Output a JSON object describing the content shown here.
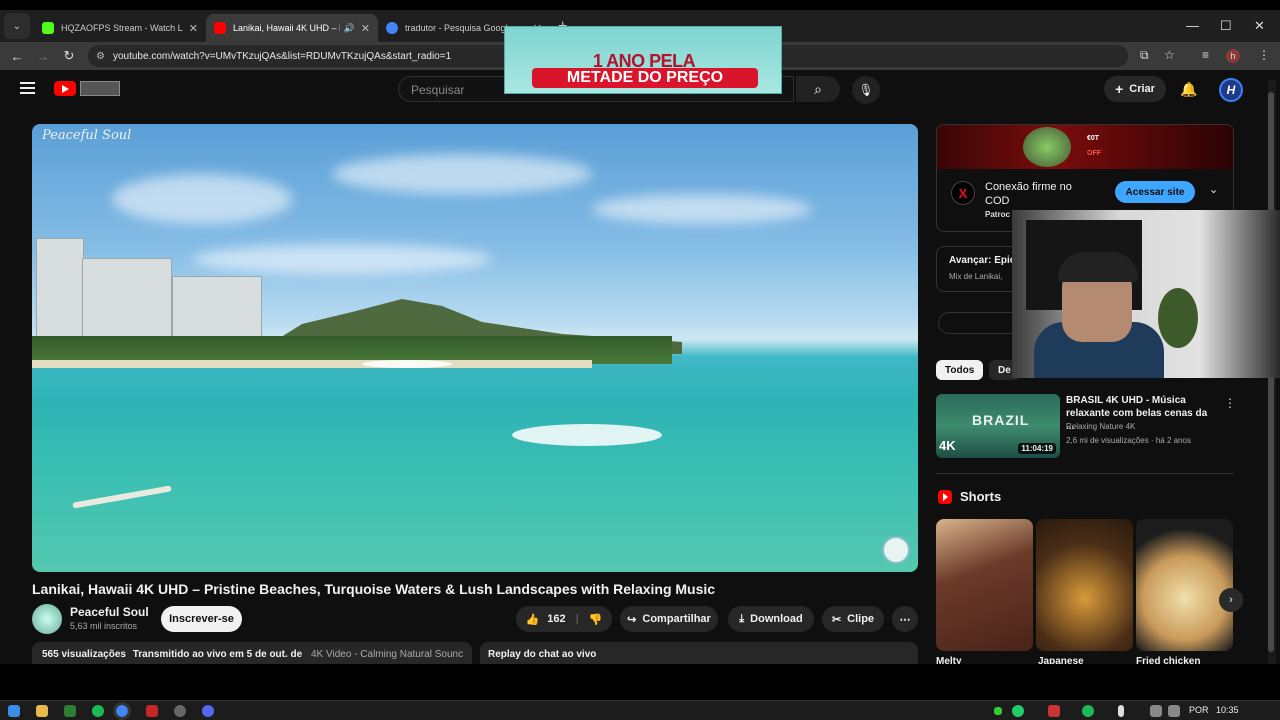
{
  "browser": {
    "tabs": [
      {
        "title": "HQZAOFPS Stream - Watch Live",
        "favicon_color": "#53fc18"
      },
      {
        "title": "Lanikai, Hawaii 4K UHD – P",
        "favicon_color": "#ff0000",
        "active": true
      },
      {
        "title": "tradutor - Pesquisa Google",
        "favicon_color": "#4285f4"
      }
    ],
    "url": "youtube.com/watch?v=UMvTKzujQAs&list=RDUMvTKzujQAs&start_radio=1",
    "profile_initial": "h"
  },
  "banner_ad": {
    "line1": "1 ANO PELA",
    "line2": "METADE DO PREÇO"
  },
  "header": {
    "search_placeholder": "Pesquisar",
    "create_label": "Criar",
    "avatar_letter": "H"
  },
  "player": {
    "watermark": "Peaceful Soul"
  },
  "video": {
    "title": "Lanikai, Hawaii 4K UHD – Pristine Beaches, Turquoise Waters & Lush Landscapes with Relaxing Music",
    "channel": "Peaceful Soul",
    "subscribers": "5,63 mil inscritos",
    "subscribe_label": "Inscrever-se",
    "likes": "162",
    "share_label": "Compartilhar",
    "download_label": "Download",
    "clip_label": "Clipe",
    "views": "565 visualizações",
    "streamed": "Transmitido ao vivo em 5 de out. de",
    "tags": "4K Video - Calming Natural Sounc",
    "chat_replay": "Replay do chat ao vivo"
  },
  "side_ad": {
    "tag_line1": "€0T",
    "tag_line2": "OFF",
    "logo": "X",
    "text": "Conexão firme no COD",
    "sponsored": "Patroc",
    "cta": "Acessar site"
  },
  "up_next": {
    "label": "Avançar: Epic",
    "sub": "Mix de Lanikai,"
  },
  "chips": [
    "Todos",
    "De"
  ],
  "related": {
    "thumb_title": "BRAZIL",
    "thumb_badge": "4K",
    "duration": "11:04:19",
    "title": "BRASIL 4K UHD - Música relaxante com belas cenas da ...",
    "channel": "Relaxing Nature 4K",
    "meta": "2,6 mi de visualizações · há 2 anos"
  },
  "shorts": {
    "title": "Shorts",
    "items": [
      {
        "label": "Melty",
        "colors": [
          "#6b3a2a",
          "#4a2418"
        ]
      },
      {
        "label": "Japanese",
        "colors": [
          "#4a2d16",
          "#b07a3a"
        ]
      },
      {
        "label": "Fried chicken",
        "colors": [
          "#1c1c1c",
          "#e8c98a"
        ]
      }
    ]
  },
  "taskbar": {
    "lang": "POR",
    "time": "10:35"
  }
}
